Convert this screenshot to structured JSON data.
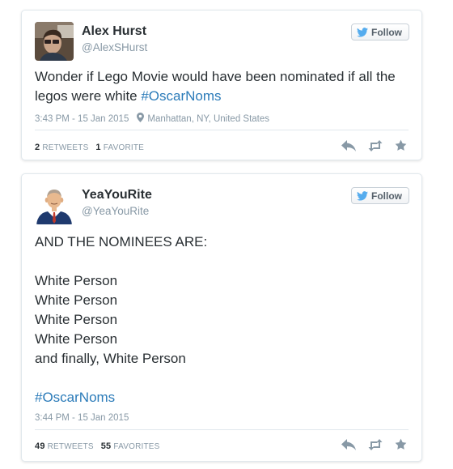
{
  "tweets": [
    {
      "name": "Alex Hurst",
      "handle": "@AlexSHurst",
      "follow_label": "Follow",
      "text_plain": "Wonder if Lego Movie would have been nominated if all the legos were white ",
      "hashtag": "#OscarNoms",
      "time": "3:43 PM - 15 Jan 2015",
      "location": "Manhattan, NY, United States",
      "retweets": "2",
      "retweets_label": "RETWEETS",
      "favorites": "1",
      "favorites_label": "FAVORITE"
    },
    {
      "name": "YeaYouRite",
      "handle": "@YeaYouRite",
      "follow_label": "Follow",
      "lines": [
        "AND THE NOMINEES ARE:",
        "",
        "White Person",
        "White Person",
        "White Person",
        "White Person",
        "and finally, White Person",
        ""
      ],
      "hashtag": "#OscarNoms",
      "time": "3:44 PM - 15 Jan 2015",
      "retweets": "49",
      "retweets_label": "RETWEETS",
      "favorites": "55",
      "favorites_label": "FAVORITES"
    }
  ],
  "icons": {
    "follow": "twitter-bird-icon",
    "location": "location-pin-icon",
    "reply": "reply-icon",
    "retweet": "retweet-icon",
    "favorite": "star-icon"
  },
  "colors": {
    "hashtag": "#2b7bb9",
    "meta": "#8899a6",
    "text": "#292f33",
    "twitter_blue": "#55acee"
  }
}
